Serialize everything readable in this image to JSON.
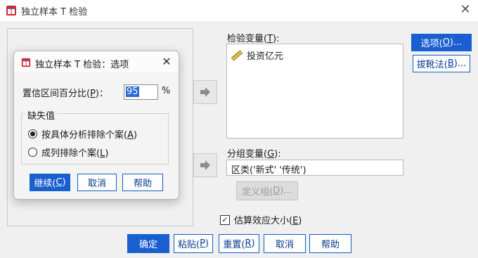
{
  "window": {
    "title": "独立样本 T 检验",
    "close_glyph": "✕",
    "app_icon": "spss-table-icon"
  },
  "test_vars": {
    "label": "检验变量(",
    "label_key": "T",
    "label_suffix": "):",
    "items": [
      {
        "name": "投资亿元",
        "icon": "ruler-scale-icon"
      }
    ]
  },
  "group_var": {
    "label": "分组变量(",
    "label_key": "G",
    "label_suffix": "):",
    "value": "区类('新式' '传统')"
  },
  "define_groups": {
    "label": "定义组(",
    "key": "D",
    "suffix": ")..."
  },
  "side_buttons": {
    "options": {
      "label": "选项(",
      "key": "O",
      "suffix": ")..."
    },
    "bootstrap": {
      "label": "拔靴法(",
      "key": "B",
      "suffix": ")..."
    }
  },
  "effect_size": {
    "checked": true,
    "label": "估算效应大小(",
    "key": "E",
    "suffix": ")"
  },
  "footer": {
    "ok": "确定",
    "paste": {
      "label": "粘贴(",
      "key": "P",
      "suffix": ")"
    },
    "reset": {
      "label": "重置(",
      "key": "R",
      "suffix": ")"
    },
    "cancel": "取消",
    "help": "帮助"
  },
  "sub_dialog": {
    "title": "独立样本 T 检验：选项",
    "close_glyph": "✕",
    "ci_label": "置信区间百分比(",
    "ci_key": "P",
    "ci_suffix": ")：",
    "ci_value": "95",
    "ci_unit": "%",
    "missing": {
      "title": "缺失值",
      "options": [
        {
          "label": "按具体分析排除个案(",
          "key": "A",
          "suffix": ")",
          "selected": true
        },
        {
          "label": "成列排除个案(",
          "key": "L",
          "suffix": ")",
          "selected": false
        }
      ]
    },
    "buttons": {
      "continue": {
        "label": "继续(",
        "key": "C",
        "suffix": ")"
      },
      "cancel": "取消",
      "help": "帮助"
    }
  },
  "colors": {
    "accent": "#1a5fd0",
    "button_border": "#0f5fc5",
    "disabled": "#dcdcdc"
  }
}
